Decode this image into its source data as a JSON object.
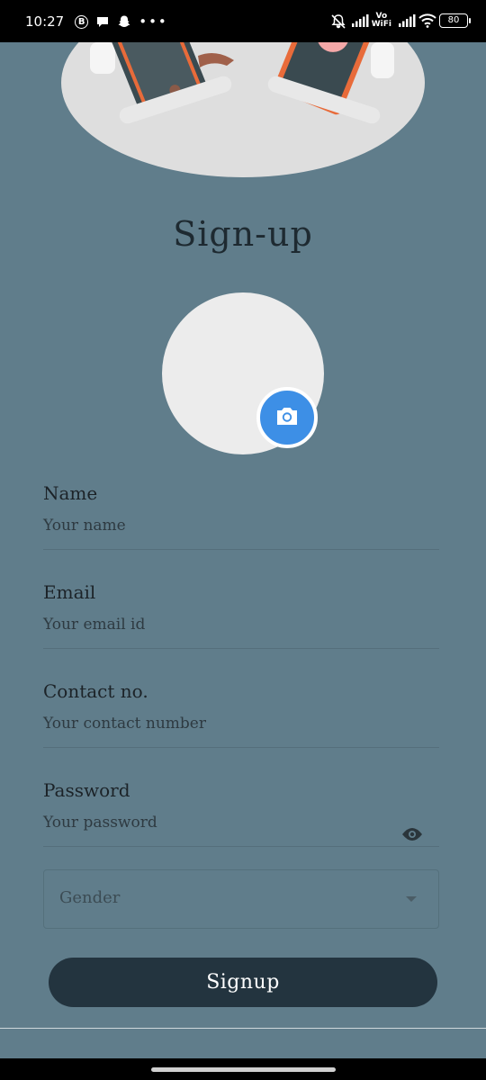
{
  "status_bar": {
    "time": "10:27",
    "battery": "80",
    "network_label_top": "Vo",
    "network_label_bottom": "WiFi"
  },
  "page": {
    "title": "Sign-up"
  },
  "form": {
    "name": {
      "label": "Name",
      "placeholder": "Your name"
    },
    "email": {
      "label": "Email",
      "placeholder": "Your email id"
    },
    "contact": {
      "label": "Contact no.",
      "placeholder": "Your contact number"
    },
    "password": {
      "label": "Password",
      "placeholder": "Your password"
    },
    "gender": {
      "placeholder": "Gender"
    },
    "submit_label": "Signup"
  },
  "colors": {
    "background": "#607d8b",
    "button": "#23343f",
    "camera_accent": "#3d8fe6"
  }
}
